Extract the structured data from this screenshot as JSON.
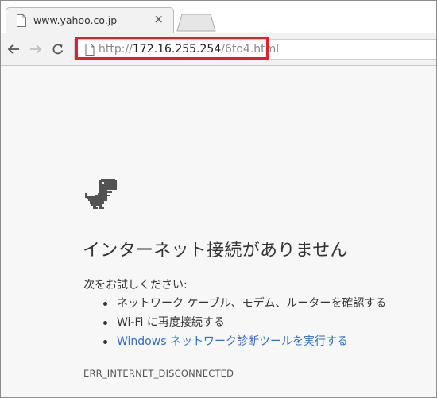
{
  "tab": {
    "title": "www.yahoo.co.jp",
    "close_glyph": "×"
  },
  "icons": {
    "tab_favicon": "page-icon",
    "back": "back-arrow-icon",
    "forward": "forward-arrow-icon",
    "reload": "reload-icon",
    "omnibox_page": "page-icon"
  },
  "omnibox": {
    "scheme": "http://",
    "host": "172.16.255.254",
    "path": "/6to4.html"
  },
  "error_page": {
    "headline": "インターネット接続がありません",
    "try_label": "次をお試しください:",
    "suggestions": [
      "ネットワーク ケーブル、モデム、ルーターを確認する",
      "Wi-Fi に再度接続する",
      "Windows ネットワーク診断ツールを実行する"
    ],
    "error_code": "ERR_INTERNET_DISCONNECTED"
  },
  "colors": {
    "highlight_border": "#e0202a",
    "link": "#2f6ec9",
    "text": "#333333"
  }
}
